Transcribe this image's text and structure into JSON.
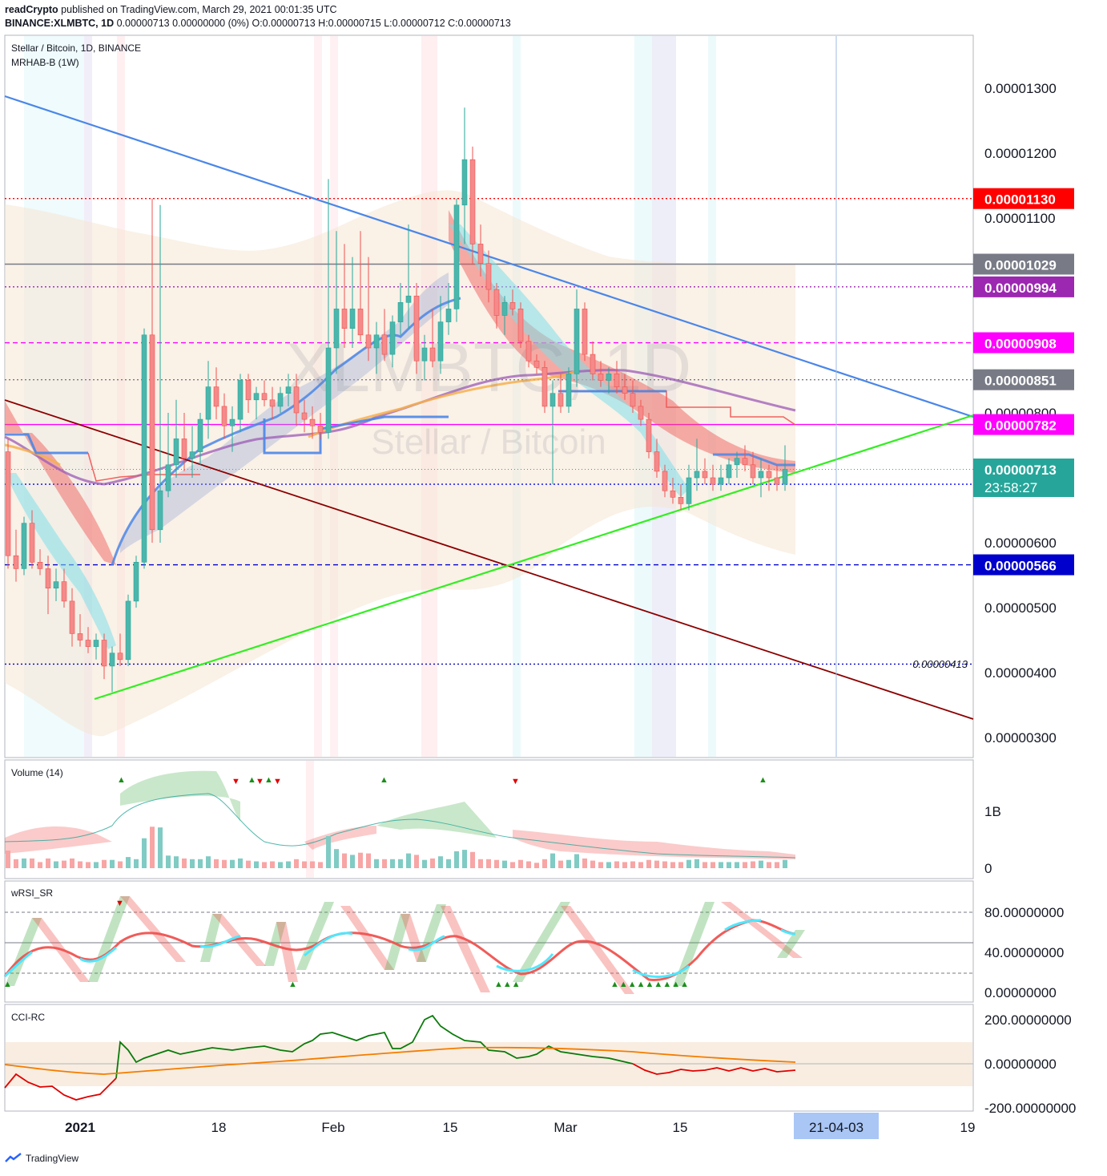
{
  "header": {
    "author": "readCrypto",
    "published": " published on TradingView.com, March 29, 2021 00:01:35 UTC",
    "symbol": "BINANCE:XLMBTC, 1D",
    "ohlc": " 0.00000713 0.00000000 (0%) O:0.00000713 H:0.00000715 L:0.00000712 C:0.00000713"
  },
  "watermark": {
    "ticker": "XLMBTC, 1D",
    "name": "Stellar / Bitcoin"
  },
  "panes": {
    "main": {
      "title": "Stellar / Bitcoin, 1D, BINANCE",
      "indicator": "MRHAB-B (1W)"
    },
    "volume": {
      "title": "Volume (14)"
    },
    "rsi": {
      "title": "wRSI_SR"
    },
    "cci": {
      "title": "CCI-RC"
    }
  },
  "footer": {
    "brand": "TradingView"
  },
  "colors": {
    "bull": "#26a69a",
    "bear": "#ef5350",
    "blue_trend": "#4a86e8",
    "green_trend": "#33ee22",
    "red_trend": "#8b0000",
    "price_label": "#26a69a"
  },
  "chart_data": {
    "type": "candlestick",
    "y_scale": {
      "ticks": [
        "0.00001300",
        "0.00001200",
        "0.00001100",
        "0.00000800",
        "0.00000600",
        "0.00000500",
        "0.00000400",
        "0.00000300"
      ],
      "tick_values": [
        1.3e-05,
        1.2e-05,
        1.1e-05,
        8e-06,
        6e-06,
        5e-06,
        4e-06,
        3e-06
      ]
    },
    "x_axis": {
      "labels": [
        "2021",
        "18",
        "Feb",
        "15",
        "Mar",
        "15",
        "21-04-03",
        "19"
      ],
      "highlight": "21-04-03"
    },
    "price_levels": [
      {
        "label": "0.00001130",
        "value": 1.13e-05,
        "color": "#ff0000",
        "style": "dotted"
      },
      {
        "label": "0.00001029",
        "value": 1.029e-05,
        "color": "#787b86",
        "style": "solid"
      },
      {
        "label": "0.00000994",
        "value": 9.94e-06,
        "color": "#9c27b0",
        "style": "dotted"
      },
      {
        "label": "0.00000908",
        "value": 9.08e-06,
        "color": "#ff00ff",
        "style": "dashed"
      },
      {
        "label": "0.00000851",
        "value": 8.51e-06,
        "color": "#787b86",
        "style": "dotted"
      },
      {
        "label": "0.00000782",
        "value": 7.82e-06,
        "color": "#ff00ff",
        "style": "solid"
      },
      {
        "label": "0.00000690",
        "value": 6.9e-06,
        "color": "#0000ff",
        "style": "dotted"
      },
      {
        "label": "0.00000566",
        "value": 5.66e-06,
        "color": "#0000cc",
        "style": "dashed"
      }
    ],
    "last_price": {
      "label": "0.00000713",
      "countdown": "23:58:27",
      "value": 7.13e-06
    },
    "low_annotation": {
      "label": "0.00000413",
      "value": 4.13e-06
    },
    "candles": [
      [
        7.4e-06,
        7.6e-06,
        5.6e-06,
        5.8e-06
      ],
      [
        5.8e-06,
        6.2e-06,
        5.4e-06,
        5.6e-06
      ],
      [
        5.6e-06,
        6.4e-06,
        5.5e-06,
        6.3e-06
      ],
      [
        6.3e-06,
        6.5e-06,
        5.6e-06,
        5.7e-06
      ],
      [
        5.7e-06,
        5.9e-06,
        5.5e-06,
        5.6e-06
      ],
      [
        5.6e-06,
        5.8e-06,
        4.9e-06,
        5.3e-06
      ],
      [
        5.3e-06,
        5.6e-06,
        5.1e-06,
        5.4e-06
      ],
      [
        5.4e-06,
        5.6e-06,
        5e-06,
        5.1e-06
      ],
      [
        5.1e-06,
        5.3e-06,
        4.4e-06,
        4.6e-06
      ],
      [
        4.6e-06,
        4.9e-06,
        4.4e-06,
        4.5e-06
      ],
      [
        4.5e-06,
        4.7e-06,
        4.3e-06,
        4.4e-06
      ],
      [
        4.4e-06,
        4.6e-06,
        4.2e-06,
        4.5e-06
      ],
      [
        4.5e-06,
        4.6e-06,
        3.9e-06,
        4.1e-06
      ],
      [
        4.1e-06,
        4.4e-06,
        3.7e-06,
        4.3e-06
      ],
      [
        4.3e-06,
        4.6e-06,
        4.1e-06,
        4.2e-06
      ],
      [
        4.2e-06,
        5.2e-06,
        4.1e-06,
        5.1e-06
      ],
      [
        5.1e-06,
        5.8e-06,
        5e-06,
        5.7e-06
      ],
      [
        5.7e-06,
        9.3e-06,
        5.6e-06,
        9.2e-06
      ],
      [
        9.2e-06,
        1.13e-05,
        6e-06,
        6.2e-06
      ],
      [
        6.2e-06,
        1.12e-05,
        6e-06,
        6.8e-06
      ],
      [
        6.8e-06,
        8e-06,
        6.7e-06,
        7.2e-06
      ],
      [
        7.2e-06,
        8.2e-06,
        7e-06,
        7.6e-06
      ],
      [
        7.6e-06,
        8e-06,
        7.1e-06,
        7.3e-06
      ],
      [
        7.3e-06,
        7.8e-06,
        7e-06,
        7.4e-06
      ],
      [
        7.4e-06,
        8e-06,
        7.2e-06,
        7.9e-06
      ],
      [
        7.9e-06,
        8.8e-06,
        7.6e-06,
        8.4e-06
      ],
      [
        8.4e-06,
        8.7e-06,
        7.9e-06,
        8.1e-06
      ],
      [
        8.1e-06,
        8.3e-06,
        7.6e-06,
        7.8e-06
      ],
      [
        7.8e-06,
        8.1e-06,
        7.4e-06,
        7.9e-06
      ],
      [
        7.9e-06,
        8.6e-06,
        7.7e-06,
        8.5e-06
      ],
      [
        8.5e-06,
        8.6e-06,
        8e-06,
        8.2e-06
      ],
      [
        8.2e-06,
        8.4e-06,
        7.9e-06,
        8.3e-06
      ],
      [
        8.3e-06,
        8.5e-06,
        8.1e-06,
        8.2e-06
      ],
      [
        8.2e-06,
        8.4e-06,
        7.9e-06,
        8.1e-06
      ],
      [
        8.1e-06,
        8.4e-06,
        8e-06,
        8.3e-06
      ],
      [
        8.3e-06,
        8.6e-06,
        8.1e-06,
        8.4e-06
      ],
      [
        8.4e-06,
        8.6e-06,
        7.8e-06,
        8e-06
      ],
      [
        8e-06,
        8.2e-06,
        7.7e-06,
        7.9e-06
      ],
      [
        7.9e-06,
        8.1e-06,
        7.6e-06,
        7.8e-06
      ],
      [
        7.8e-06,
        8e-06,
        7.6e-06,
        7.7e-06
      ],
      [
        7.7e-06,
        1.16e-05,
        7.6e-06,
        9e-06
      ],
      [
        9e-06,
        1.08e-05,
        8.6e-06,
        9.6e-06
      ],
      [
        9.6e-06,
        1.06e-05,
        9e-06,
        9.3e-06
      ],
      [
        9.3e-06,
        1.04e-05,
        9e-06,
        9.6e-06
      ],
      [
        9.6e-06,
        1.08e-05,
        9.1e-06,
        9.2e-06
      ],
      [
        9.2e-06,
        1.04e-05,
        8.8e-06,
        9e-06
      ],
      [
        9e-06,
        9.4e-06,
        8.6e-06,
        9.2e-06
      ],
      [
        9.2e-06,
        9.6e-06,
        8.8e-06,
        8.9e-06
      ],
      [
        8.9e-06,
        9.5e-06,
        8.7e-06,
        9.4e-06
      ],
      [
        9.4e-06,
        1e-05,
        9.2e-06,
        9.7e-06
      ],
      [
        9.7e-06,
        1.09e-05,
        9.3e-06,
        9.8e-06
      ],
      [
        9.8e-06,
        1e-05,
        8.6e-06,
        8.8e-06
      ],
      [
        8.8e-06,
        9.2e-06,
        8.5e-06,
        9e-06
      ],
      [
        9e-06,
        9.6e-06,
        8.7e-06,
        8.8e-06
      ],
      [
        8.8e-06,
        9.8e-06,
        8.6e-06,
        9.4e-06
      ],
      [
        9.4e-06,
        1e-05,
        9.2e-06,
        9.6e-06
      ],
      [
        9.6e-06,
        1.13e-05,
        9.4e-06,
        1.12e-05
      ],
      [
        1.12e-05,
        1.27e-05,
        1.06e-05,
        1.19e-05
      ],
      [
        1.19e-05,
        1.21e-05,
        1.03e-05,
        1.06e-05
      ],
      [
        1.06e-05,
        1.09e-05,
        1.01e-05,
        1.03e-05
      ],
      [
        1.03e-05,
        1.05e-05,
        9.7e-06,
        9.9e-06
      ],
      [
        9.9e-06,
        1e-05,
        9.3e-06,
        9.5e-06
      ],
      [
        9.5e-06,
        9.8e-06,
        9.2e-06,
        9.7e-06
      ],
      [
        9.7e-06,
        9.9e-06,
        9.5e-06,
        9.6e-06
      ],
      [
        9.6e-06,
        9.7e-06,
        9e-06,
        9.1e-06
      ],
      [
        9.1e-06,
        9.2e-06,
        8.7e-06,
        8.8e-06
      ],
      [
        8.8e-06,
        8.9e-06,
        8.6e-06,
        8.7e-06
      ],
      [
        8.7e-06,
        8.8e-06,
        8e-06,
        8.1e-06
      ],
      [
        8.1e-06,
        8.5e-06,
        6.9e-06,
        8.3e-06
      ],
      [
        8.3e-06,
        8.6e-06,
        8e-06,
        8.1e-06
      ],
      [
        8.1e-06,
        8.7e-06,
        8e-06,
        8.6e-06
      ],
      [
        8.6e-06,
        9.9e-06,
        8.4e-06,
        9.6e-06
      ],
      [
        9.6e-06,
        9.7e-06,
        8.8e-06,
        8.9e-06
      ],
      [
        8.9e-06,
        9.1e-06,
        8.5e-06,
        8.6e-06
      ],
      [
        8.6e-06,
        8.8e-06,
        8.4e-06,
        8.5e-06
      ],
      [
        8.5e-06,
        8.7e-06,
        8.3e-06,
        8.6e-06
      ],
      [
        8.6e-06,
        8.8e-06,
        8.3e-06,
        8.4e-06
      ],
      [
        8.4e-06,
        8.6e-06,
        8.2e-06,
        8.3e-06
      ],
      [
        8.3e-06,
        8.5e-06,
        8e-06,
        8.1e-06
      ],
      [
        8.1e-06,
        8.2e-06,
        7.8e-06,
        7.9e-06
      ],
      [
        7.9e-06,
        8e-06,
        7.3e-06,
        7.4e-06
      ],
      [
        7.4e-06,
        7.6e-06,
        7e-06,
        7.1e-06
      ],
      [
        7.1e-06,
        7.2e-06,
        6.7e-06,
        6.8e-06
      ],
      [
        6.8e-06,
        7e-06,
        6.6e-06,
        6.7e-06
      ],
      [
        6.7e-06,
        6.9e-06,
        6.5e-06,
        6.6e-06
      ],
      [
        6.6e-06,
        7.2e-06,
        6.5e-06,
        7e-06
      ],
      [
        7e-06,
        7.6e-06,
        6.8e-06,
        7.1e-06
      ],
      [
        7.1e-06,
        7.3e-06,
        6.9e-06,
        7e-06
      ],
      [
        7e-06,
        7.2e-06,
        6.8e-06,
        6.9e-06
      ],
      [
        6.9e-06,
        7.2e-06,
        6.8e-06,
        7e-06
      ],
      [
        7e-06,
        7.3e-06,
        6.9e-06,
        7.2e-06
      ],
      [
        7.2e-06,
        7.4e-06,
        7e-06,
        7.3e-06
      ],
      [
        7.3e-06,
        7.5e-06,
        7.1e-06,
        7.2e-06
      ],
      [
        7.2e-06,
        7.4e-06,
        6.9e-06,
        7e-06
      ],
      [
        7e-06,
        7.3e-06,
        6.7e-06,
        7.1e-06
      ],
      [
        7.1e-06,
        7.2e-06,
        6.8e-06,
        7e-06
      ],
      [
        7e-06,
        7.2e-06,
        6.8e-06,
        6.9e-06
      ],
      [
        6.9e-06,
        7.5e-06,
        6.8e-06,
        7.13e-06
      ]
    ],
    "volume_pane": {
      "ticks": [
        "1B",
        "0"
      ],
      "tick_values": [
        1000000000,
        0
      ]
    },
    "rsi_pane": {
      "ticks": [
        "80.00000000",
        "40.00000000",
        "0.00000000"
      ],
      "tick_values": [
        80,
        40,
        0
      ]
    },
    "cci_pane": {
      "ticks": [
        "200.00000000",
        "0.00000000",
        "-200.00000000"
      ],
      "tick_values": [
        200,
        0,
        -200
      ]
    }
  }
}
